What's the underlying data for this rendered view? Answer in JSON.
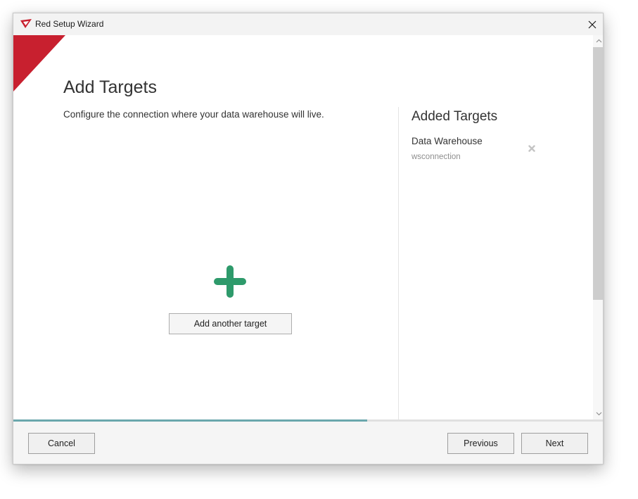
{
  "window": {
    "title": "Red Setup Wizard",
    "app_icon": "red-chevron-logo",
    "close_icon": "close-x"
  },
  "page": {
    "title": "Add Targets",
    "subtitle": "Configure the connection where your data warehouse will live."
  },
  "add_target": {
    "icon": "plus-icon",
    "icon_color": "#2e9a6b",
    "button_label": "Add another target"
  },
  "added_targets": {
    "title": "Added Targets",
    "items": [
      {
        "name": "Data Warehouse",
        "connection": "wsconnection",
        "remove_icon": "remove-x"
      }
    ]
  },
  "wizard_progress": 0.6,
  "footer": {
    "cancel_label": "Cancel",
    "previous_label": "Previous",
    "next_label": "Next"
  },
  "colors": {
    "brand_red": "#c8202f",
    "progress": "#6aa7ad",
    "plus_green": "#2e9a6b"
  }
}
